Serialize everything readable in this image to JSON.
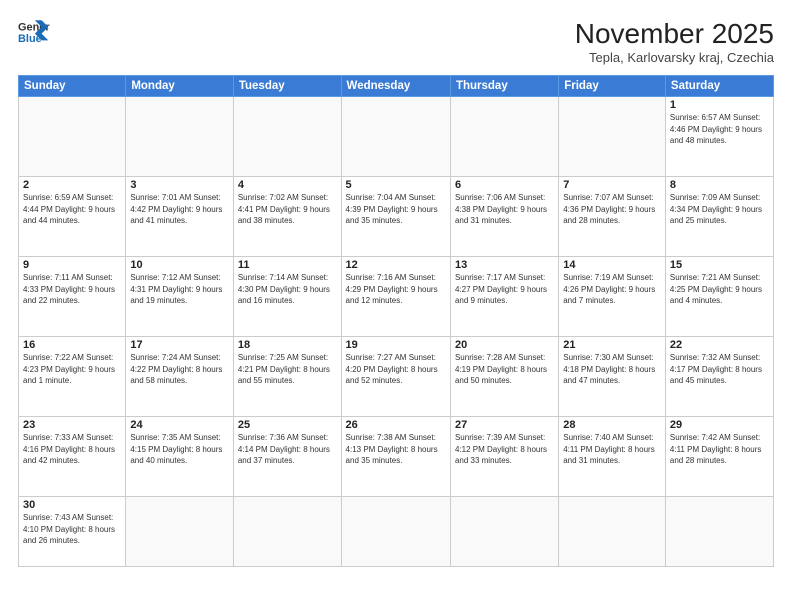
{
  "header": {
    "logo_general": "General",
    "logo_blue": "Blue",
    "month_title": "November 2025",
    "location": "Tepla, Karlovarsky kraj, Czechia"
  },
  "days_of_week": [
    "Sunday",
    "Monday",
    "Tuesday",
    "Wednesday",
    "Thursday",
    "Friday",
    "Saturday"
  ],
  "weeks": [
    [
      {
        "day": "",
        "info": ""
      },
      {
        "day": "",
        "info": ""
      },
      {
        "day": "",
        "info": ""
      },
      {
        "day": "",
        "info": ""
      },
      {
        "day": "",
        "info": ""
      },
      {
        "day": "",
        "info": ""
      },
      {
        "day": "1",
        "info": "Sunrise: 6:57 AM\nSunset: 4:46 PM\nDaylight: 9 hours\nand 48 minutes."
      }
    ],
    [
      {
        "day": "2",
        "info": "Sunrise: 6:59 AM\nSunset: 4:44 PM\nDaylight: 9 hours\nand 44 minutes."
      },
      {
        "day": "3",
        "info": "Sunrise: 7:01 AM\nSunset: 4:42 PM\nDaylight: 9 hours\nand 41 minutes."
      },
      {
        "day": "4",
        "info": "Sunrise: 7:02 AM\nSunset: 4:41 PM\nDaylight: 9 hours\nand 38 minutes."
      },
      {
        "day": "5",
        "info": "Sunrise: 7:04 AM\nSunset: 4:39 PM\nDaylight: 9 hours\nand 35 minutes."
      },
      {
        "day": "6",
        "info": "Sunrise: 7:06 AM\nSunset: 4:38 PM\nDaylight: 9 hours\nand 31 minutes."
      },
      {
        "day": "7",
        "info": "Sunrise: 7:07 AM\nSunset: 4:36 PM\nDaylight: 9 hours\nand 28 minutes."
      },
      {
        "day": "8",
        "info": "Sunrise: 7:09 AM\nSunset: 4:34 PM\nDaylight: 9 hours\nand 25 minutes."
      }
    ],
    [
      {
        "day": "9",
        "info": "Sunrise: 7:11 AM\nSunset: 4:33 PM\nDaylight: 9 hours\nand 22 minutes."
      },
      {
        "day": "10",
        "info": "Sunrise: 7:12 AM\nSunset: 4:31 PM\nDaylight: 9 hours\nand 19 minutes."
      },
      {
        "day": "11",
        "info": "Sunrise: 7:14 AM\nSunset: 4:30 PM\nDaylight: 9 hours\nand 16 minutes."
      },
      {
        "day": "12",
        "info": "Sunrise: 7:16 AM\nSunset: 4:29 PM\nDaylight: 9 hours\nand 12 minutes."
      },
      {
        "day": "13",
        "info": "Sunrise: 7:17 AM\nSunset: 4:27 PM\nDaylight: 9 hours\nand 9 minutes."
      },
      {
        "day": "14",
        "info": "Sunrise: 7:19 AM\nSunset: 4:26 PM\nDaylight: 9 hours\nand 7 minutes."
      },
      {
        "day": "15",
        "info": "Sunrise: 7:21 AM\nSunset: 4:25 PM\nDaylight: 9 hours\nand 4 minutes."
      }
    ],
    [
      {
        "day": "16",
        "info": "Sunrise: 7:22 AM\nSunset: 4:23 PM\nDaylight: 9 hours\nand 1 minute."
      },
      {
        "day": "17",
        "info": "Sunrise: 7:24 AM\nSunset: 4:22 PM\nDaylight: 8 hours\nand 58 minutes."
      },
      {
        "day": "18",
        "info": "Sunrise: 7:25 AM\nSunset: 4:21 PM\nDaylight: 8 hours\nand 55 minutes."
      },
      {
        "day": "19",
        "info": "Sunrise: 7:27 AM\nSunset: 4:20 PM\nDaylight: 8 hours\nand 52 minutes."
      },
      {
        "day": "20",
        "info": "Sunrise: 7:28 AM\nSunset: 4:19 PM\nDaylight: 8 hours\nand 50 minutes."
      },
      {
        "day": "21",
        "info": "Sunrise: 7:30 AM\nSunset: 4:18 PM\nDaylight: 8 hours\nand 47 minutes."
      },
      {
        "day": "22",
        "info": "Sunrise: 7:32 AM\nSunset: 4:17 PM\nDaylight: 8 hours\nand 45 minutes."
      }
    ],
    [
      {
        "day": "23",
        "info": "Sunrise: 7:33 AM\nSunset: 4:16 PM\nDaylight: 8 hours\nand 42 minutes."
      },
      {
        "day": "24",
        "info": "Sunrise: 7:35 AM\nSunset: 4:15 PM\nDaylight: 8 hours\nand 40 minutes."
      },
      {
        "day": "25",
        "info": "Sunrise: 7:36 AM\nSunset: 4:14 PM\nDaylight: 8 hours\nand 37 minutes."
      },
      {
        "day": "26",
        "info": "Sunrise: 7:38 AM\nSunset: 4:13 PM\nDaylight: 8 hours\nand 35 minutes."
      },
      {
        "day": "27",
        "info": "Sunrise: 7:39 AM\nSunset: 4:12 PM\nDaylight: 8 hours\nand 33 minutes."
      },
      {
        "day": "28",
        "info": "Sunrise: 7:40 AM\nSunset: 4:11 PM\nDaylight: 8 hours\nand 31 minutes."
      },
      {
        "day": "29",
        "info": "Sunrise: 7:42 AM\nSunset: 4:11 PM\nDaylight: 8 hours\nand 28 minutes."
      }
    ],
    [
      {
        "day": "30",
        "info": "Sunrise: 7:43 AM\nSunset: 4:10 PM\nDaylight: 8 hours\nand 26 minutes."
      },
      {
        "day": "",
        "info": ""
      },
      {
        "day": "",
        "info": ""
      },
      {
        "day": "",
        "info": ""
      },
      {
        "day": "",
        "info": ""
      },
      {
        "day": "",
        "info": ""
      },
      {
        "day": "",
        "info": ""
      }
    ]
  ]
}
